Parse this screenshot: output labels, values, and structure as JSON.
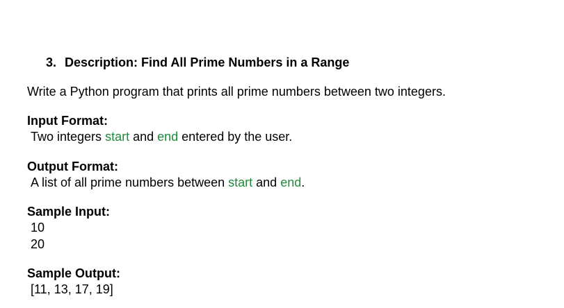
{
  "document": {
    "item_number": "3.",
    "title": "Description: Find All Prime Numbers in a Range",
    "intro": "Write a Python program that prints all prime numbers between two integers.",
    "input_format": {
      "heading": "Input Format:",
      "text_before": "Two integers ",
      "var_start": "start",
      "text_middle": " and ",
      "var_end": "end",
      "text_after": " entered by the user."
    },
    "output_format": {
      "heading": "Output Format:",
      "text_before": "A list of all prime numbers between ",
      "var_start": "start",
      "text_middle": " and ",
      "var_end": "end",
      "text_after": "."
    },
    "sample_input": {
      "heading": "Sample Input:",
      "lines": [
        "10",
        "20"
      ]
    },
    "sample_output": {
      "heading": "Sample Output:",
      "value": "[11, 13, 17, 19]"
    }
  },
  "colors": {
    "code_green": "#1e8a3a"
  }
}
